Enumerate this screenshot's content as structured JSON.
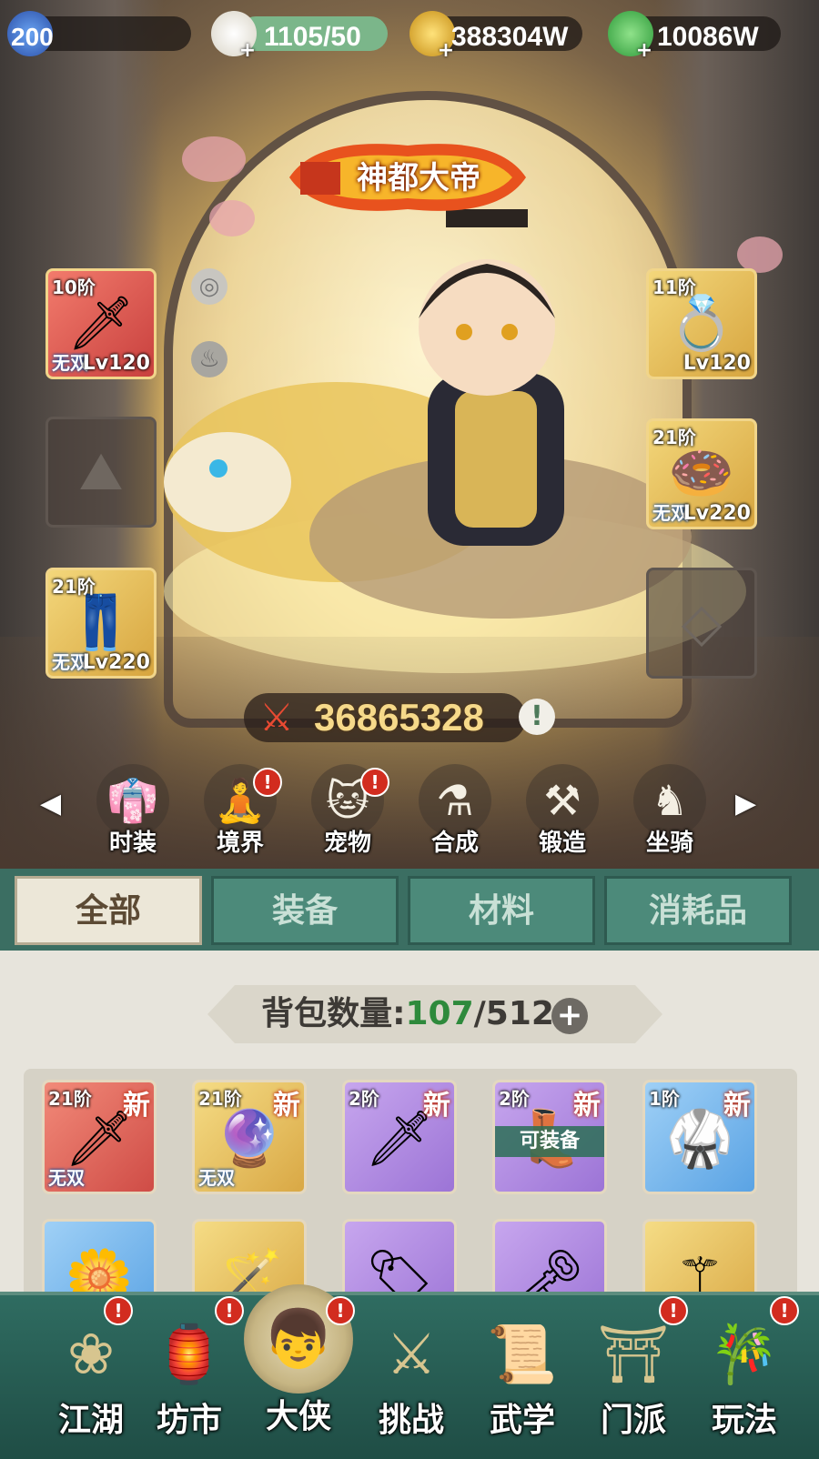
{
  "resources": {
    "level": "200",
    "stamina": "1105/50",
    "coins": "388304W",
    "jade": "10086W",
    "plus": "+"
  },
  "hero": {
    "title_banner": "神都大帝",
    "power": "36865328",
    "info_icon": "!"
  },
  "equipment_left": [
    {
      "tier": "10阶",
      "tag": "无双",
      "level": "Lv120",
      "icon": "dagger-icon",
      "glyph": "🗡"
    },
    {
      "tier": "",
      "tag": "",
      "level": "",
      "icon": "empty-armor-slot-icon",
      "glyph": ""
    },
    {
      "tier": "21阶",
      "tag": "无双",
      "level": "Lv220",
      "icon": "boots-icon",
      "glyph": "👖"
    }
  ],
  "equipment_right": [
    {
      "tier": "11阶",
      "tag": "",
      "level": "Lv120",
      "icon": "ring-icon",
      "glyph": "💍"
    },
    {
      "tier": "21阶",
      "tag": "无双",
      "level": "Lv220",
      "icon": "pendant-icon",
      "glyph": "🍩"
    },
    {
      "tier": "",
      "tag": "",
      "level": "",
      "icon": "empty-slot-icon",
      "glyph": ""
    }
  ],
  "functions": [
    {
      "label": "时装",
      "icon": "costume-icon",
      "glyph": "👘",
      "alert": false
    },
    {
      "label": "境界",
      "icon": "realm-icon",
      "glyph": "🧘",
      "alert": true
    },
    {
      "label": "宠物",
      "icon": "pet-icon",
      "glyph": "🐱",
      "alert": true
    },
    {
      "label": "合成",
      "icon": "compose-icon",
      "glyph": "⚗",
      "alert": false
    },
    {
      "label": "锻造",
      "icon": "forge-icon",
      "glyph": "⚒",
      "alert": false
    },
    {
      "label": "坐骑",
      "icon": "mount-icon",
      "glyph": "♞",
      "alert": false
    }
  ],
  "arrows": {
    "left": "◀",
    "right": "▶"
  },
  "alert_mark": "!",
  "tabs": [
    {
      "label": "全部",
      "active": true
    },
    {
      "label": "装备",
      "active": false
    },
    {
      "label": "材料",
      "active": false
    },
    {
      "label": "消耗品",
      "active": false
    }
  ],
  "bag": {
    "capacity_label": "背包数量:",
    "used": "107",
    "separator": "/",
    "total": "512",
    "plus": "+"
  },
  "items_row1": [
    {
      "tier": "21阶",
      "new": "新",
      "tag": "无双",
      "equip": "",
      "color": "red",
      "icon": "sword-icon",
      "glyph": "🗡"
    },
    {
      "tier": "21阶",
      "new": "新",
      "tag": "无双",
      "equip": "",
      "color": "gold",
      "icon": "amulet-icon",
      "glyph": "🔮"
    },
    {
      "tier": "2阶",
      "new": "新",
      "tag": "",
      "equip": "",
      "color": "purple",
      "icon": "sword-icon",
      "glyph": "🗡"
    },
    {
      "tier": "2阶",
      "new": "新",
      "tag": "",
      "equip": "可装备",
      "color": "purple",
      "icon": "boots-icon",
      "glyph": "👢"
    },
    {
      "tier": "1阶",
      "new": "新",
      "tag": "",
      "equip": "",
      "color": "blue",
      "icon": "robe-icon",
      "glyph": "🥋"
    }
  ],
  "items_row2": [
    {
      "color": "blue",
      "icon": "flower-basket-icon",
      "glyph": "🌼"
    },
    {
      "color": "gold",
      "icon": "staff-icon",
      "glyph": "🪄"
    },
    {
      "color": "purple",
      "icon": "jade-token-icon",
      "glyph": "🏷"
    },
    {
      "color": "purple",
      "icon": "key-icon",
      "glyph": "🗝"
    },
    {
      "color": "gold",
      "icon": "scepter-icon",
      "glyph": "⚚"
    }
  ],
  "nav": [
    {
      "label": "江湖",
      "icon": "jianghu-icon",
      "glyph": "❀",
      "alert": true,
      "active": false
    },
    {
      "label": "坊市",
      "icon": "market-icon",
      "glyph": "🏮",
      "alert": true,
      "active": false
    },
    {
      "label": "大侠",
      "icon": "hero-avatar-icon",
      "glyph": "👦",
      "alert": true,
      "active": true
    },
    {
      "label": "挑战",
      "icon": "challenge-icon",
      "glyph": "⚔",
      "alert": false,
      "active": false
    },
    {
      "label": "武学",
      "icon": "martial-arts-icon",
      "glyph": "📜",
      "alert": false,
      "active": false
    },
    {
      "label": "门派",
      "icon": "sect-icon",
      "glyph": "⛩",
      "alert": true,
      "active": false
    },
    {
      "label": "玩法",
      "icon": "gameplay-icon",
      "glyph": "🎋",
      "alert": true,
      "active": false
    }
  ],
  "colors": {
    "tab_active_bg": "#ece7d8",
    "tab_bg": "#4c8a7a",
    "nav_bg": "#2f6c61",
    "power_gold": "#f6d98a",
    "alert_red": "#d22c1f",
    "capacity_used_green": "#2e8a3c"
  }
}
